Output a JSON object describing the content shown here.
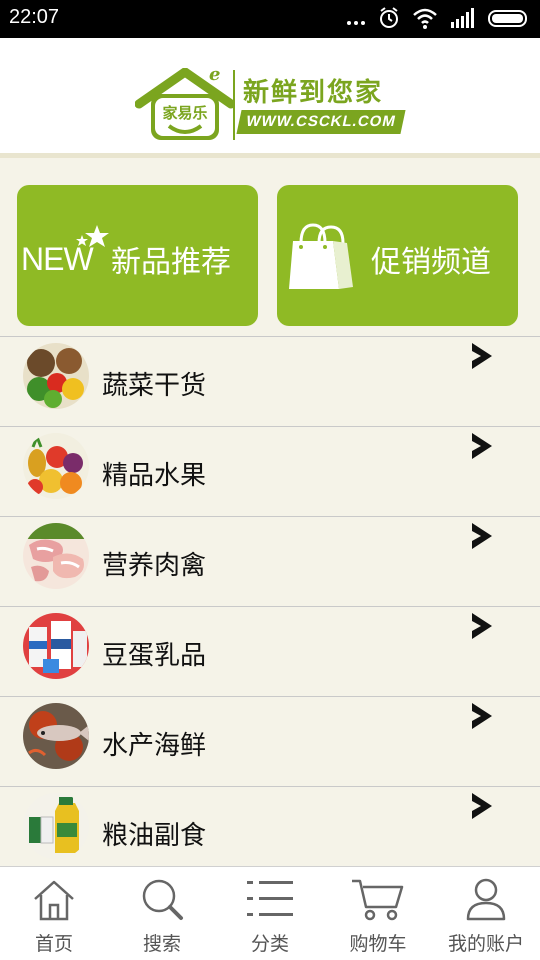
{
  "status_bar": {
    "time": "22:07",
    "icons": [
      "more-dots-icon",
      "alarm-icon",
      "wifi-icon",
      "signal-icon",
      "battery-icon"
    ]
  },
  "header": {
    "logo_text": "家易乐",
    "slogan": "新鲜到您家",
    "url": "WWW.CSCKL.COM"
  },
  "features": [
    {
      "id": "new",
      "badge": "NEW",
      "label": "新品推荐",
      "icon": "new-star-icon"
    },
    {
      "id": "promo",
      "label": "促销频道",
      "icon": "shopping-bag-icon"
    }
  ],
  "categories": [
    {
      "label": "蔬菜干货",
      "icon": "vegetables-icon"
    },
    {
      "label": "精品水果",
      "icon": "fruits-icon"
    },
    {
      "label": "营养肉禽",
      "icon": "meat-icon"
    },
    {
      "label": "豆蛋乳品",
      "icon": "dairy-icon"
    },
    {
      "label": "水产海鲜",
      "icon": "seafood-icon"
    },
    {
      "label": "粮油副食",
      "icon": "grain-oil-icon"
    }
  ],
  "tabs": [
    {
      "label": "首页",
      "icon": "home-icon"
    },
    {
      "label": "搜索",
      "icon": "search-icon"
    },
    {
      "label": "分类",
      "icon": "list-icon"
    },
    {
      "label": "购物车",
      "icon": "cart-icon"
    },
    {
      "label": "我的账户",
      "icon": "user-icon"
    }
  ],
  "colors": {
    "brand_green": "#8fba25",
    "logo_green": "#7ba51f",
    "background": "#f5f3e8"
  }
}
